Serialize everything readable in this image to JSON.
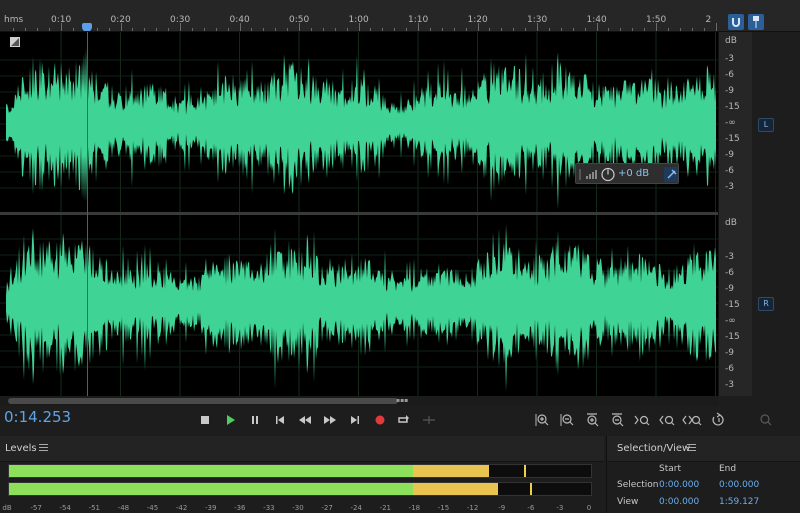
{
  "ruler": {
    "unit_label": "hms",
    "ticks": [
      "0:10",
      "0:20",
      "0:30",
      "0:40",
      "0:50",
      "1:00",
      "1:10",
      "1:20",
      "1:30",
      "1:40",
      "1:50",
      "2"
    ]
  },
  "db_scale": {
    "unit": "dB",
    "left_labels": [
      "-3",
      "-6",
      "-9",
      "-15",
      "-∞",
      "-15",
      "-9",
      "-6",
      "-3"
    ],
    "right_labels": [
      "-3",
      "-6",
      "-9",
      "-15",
      "-∞",
      "-15",
      "-9",
      "-6",
      "-3"
    ]
  },
  "channels": {
    "left": "L",
    "right": "R"
  },
  "hud": {
    "gain": "+0 dB"
  },
  "transport": {
    "timecode": "0:14.253",
    "buttons": [
      "stop",
      "play",
      "pause",
      "go-to-start",
      "rewind",
      "fast-forward",
      "go-to-end",
      "record",
      "loop",
      "skip-selection"
    ]
  },
  "levels": {
    "title": "Levels",
    "ticks": [
      "dB",
      "-57",
      "-54",
      "-51",
      "-48",
      "-45",
      "-42",
      "-39",
      "-36",
      "-33",
      "-30",
      "-27",
      "-24",
      "-21",
      "-18",
      "-15",
      "-12",
      "-9",
      "-6",
      "-3",
      "0"
    ],
    "channel_top": {
      "green_fraction": 0.695,
      "yellow_fraction": 0.13,
      "peak_fraction": 0.885
    },
    "channel_bottom": {
      "green_fraction": 0.695,
      "yellow_fraction": 0.145,
      "peak_fraction": 0.895
    },
    "colors": {
      "green": "#8de05a",
      "yellow": "#e9c451"
    }
  },
  "selection_view": {
    "title": "Selection/View",
    "col_start": "Start",
    "col_end": "End",
    "selection_label": "Selection",
    "selection_start": "0:00.000",
    "selection_end": "0:00.000",
    "view_label": "View",
    "view_start": "0:00.000",
    "view_end": "1:59.127"
  },
  "colors": {
    "waveform": "#3fd495",
    "playhead": "#d8262c",
    "accent": "#5ea4ea"
  }
}
